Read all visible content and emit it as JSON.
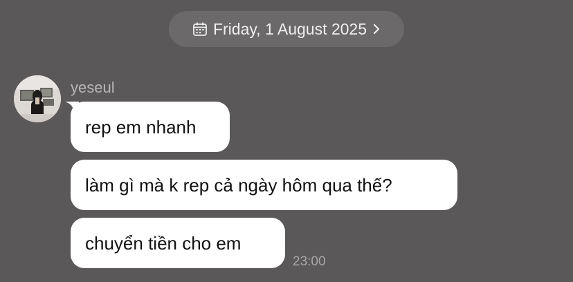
{
  "date_header": {
    "icon": "calendar-icon",
    "label": "Friday, 1 August 2025",
    "chevron": "chevron-right-icon"
  },
  "conversation": {
    "sender": "yeseul",
    "avatar_icon": "avatar",
    "messages": [
      {
        "text": "rep em nhanh"
      },
      {
        "text": "làm gì mà k rep cả ngày hôm qua thế?"
      },
      {
        "text": "chuyển tiền cho em"
      }
    ],
    "timestamp": "23:00"
  },
  "colors": {
    "background": "#5a5859",
    "date_pill": "#6b696a",
    "bubble": "#ffffff",
    "sender_name": "#b8b6b7",
    "timestamp": "#a9a7a8"
  }
}
